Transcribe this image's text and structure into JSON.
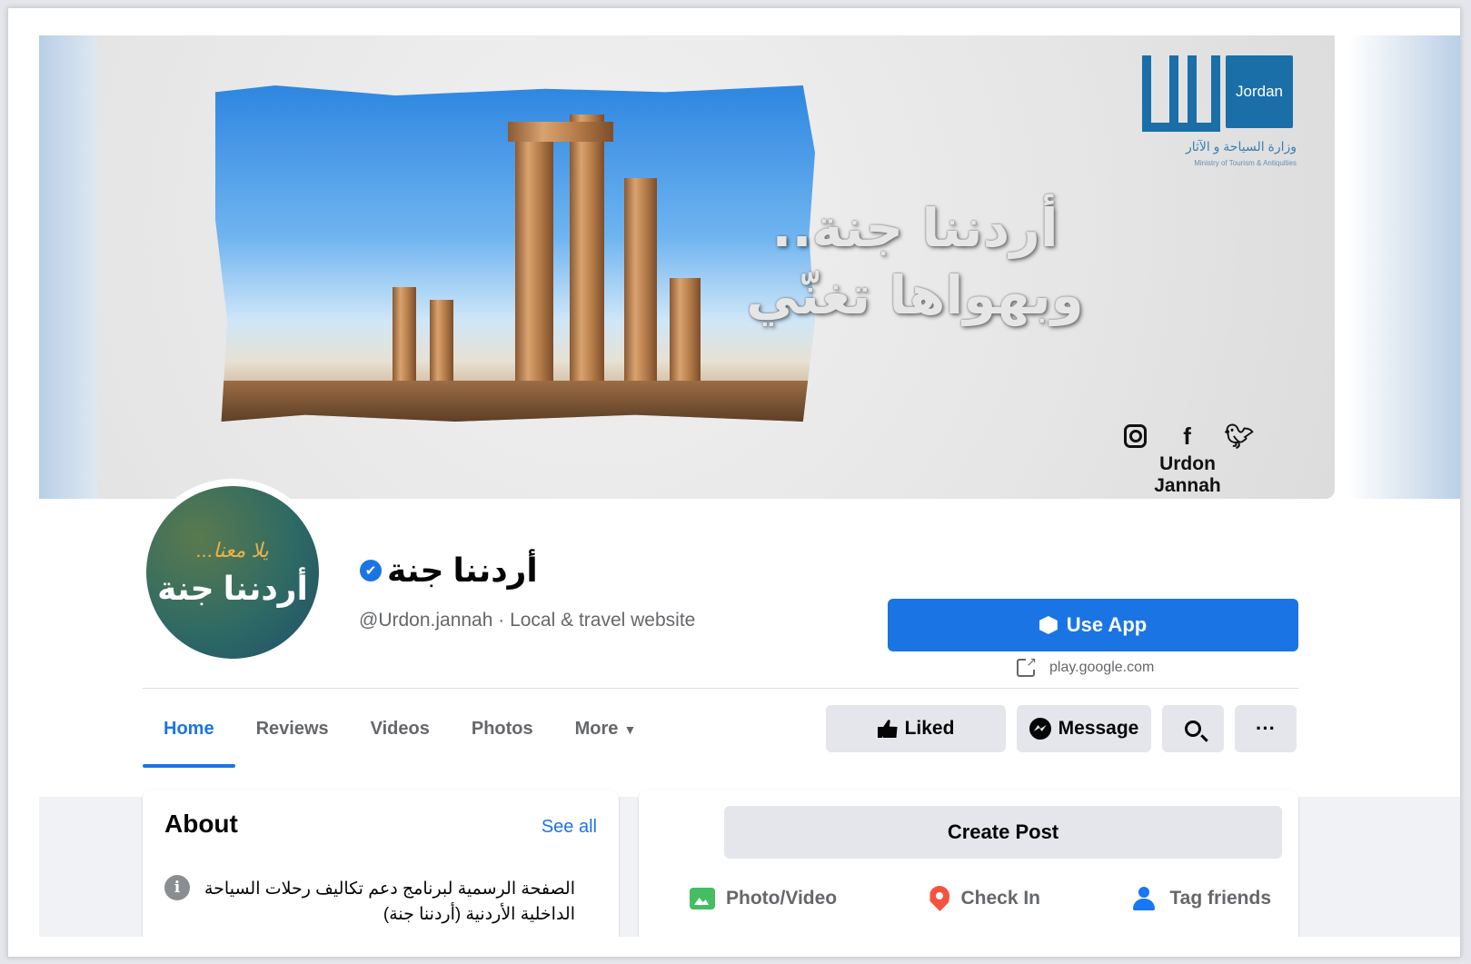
{
  "colors": {
    "accent": "#1b74e4",
    "background": "#f0f2f5",
    "button_gray": "#e4e6eb",
    "text_secondary": "#65676b"
  },
  "cover": {
    "tagline_line1": "أردننا جنة..",
    "tagline_line2": "وبهواها تغنّي",
    "logo_box_text": "Jordan",
    "logo_arabic": "وزارة السياحة و الآثار",
    "logo_english": "Ministry of Tourism & Antiquities",
    "social_icons": [
      "instagram-icon",
      "facebook-icon",
      "twitter-icon"
    ],
    "social_handle": "Urdon Jannah"
  },
  "profile": {
    "avatar_top": "يلا معنا...",
    "avatar_main": "أردننا جنة",
    "name": "أردننا جنة",
    "verified_mark": "✔",
    "subtitle": "@Urdon.jannah · Local & travel website"
  },
  "cta": {
    "use_app_label": "Use App",
    "link_text": "play.google.com"
  },
  "tabs": [
    {
      "label": "Home",
      "active": true
    },
    {
      "label": "Reviews"
    },
    {
      "label": "Videos"
    },
    {
      "label": "Photos"
    },
    {
      "label": "More"
    }
  ],
  "actions": {
    "liked_label": "Liked",
    "message_label": "Message",
    "more_label": "···"
  },
  "about": {
    "title": "About",
    "see_all": "See all",
    "info_glyph": "i",
    "text": "الصفحة الرسمية لبرنامج دعم تكاليف رحلات السياحة الداخلية الأردنية (أردننا جنة)"
  },
  "composer": {
    "create_post": "Create Post",
    "photo_video": "Photo/Video",
    "check_in": "Check In",
    "tag_friends": "Tag friends"
  }
}
